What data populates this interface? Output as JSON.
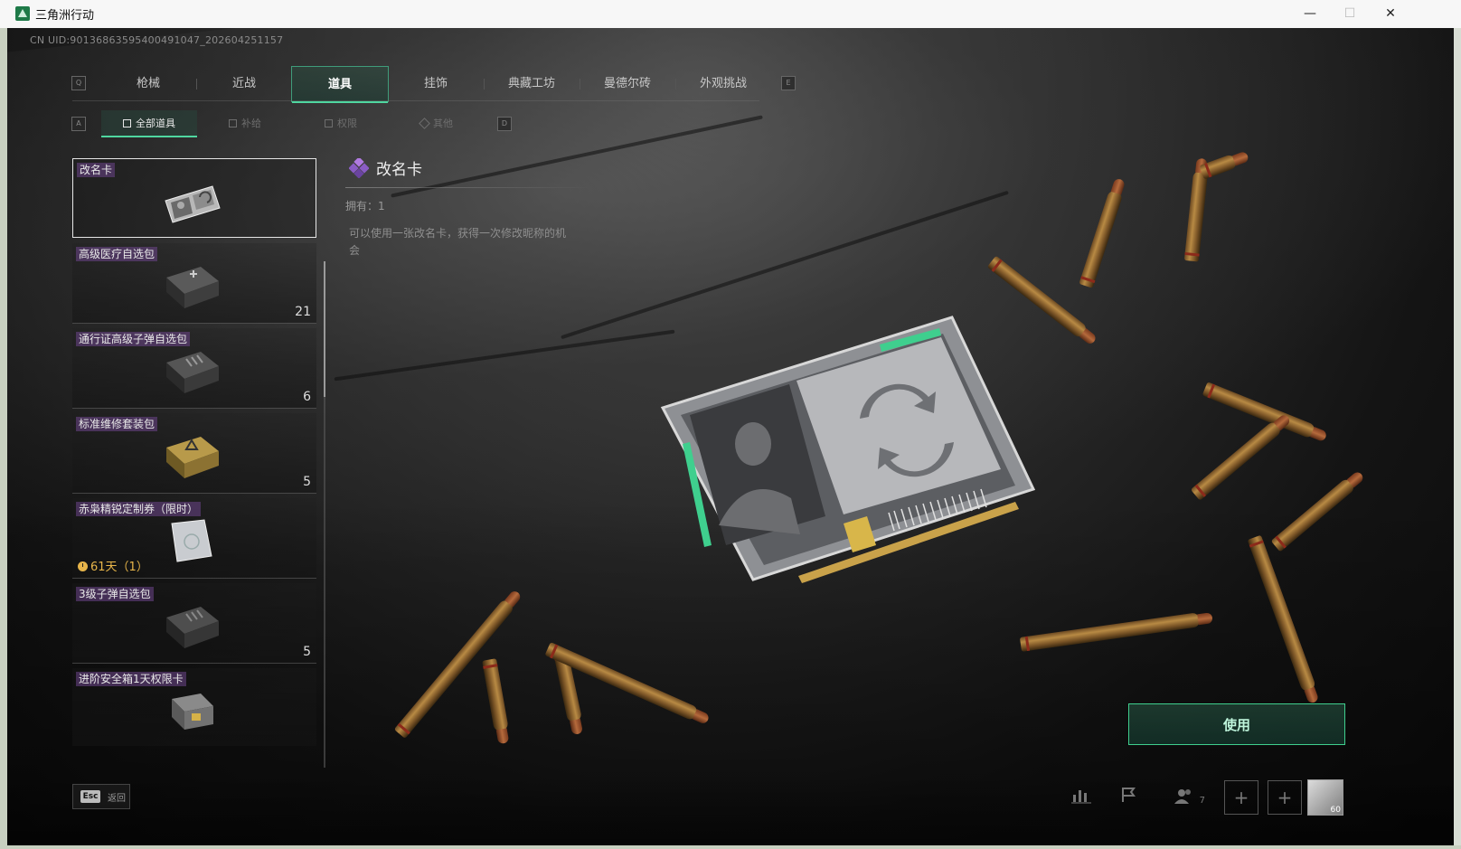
{
  "window": {
    "title": "三角洲行动",
    "minimize": "—",
    "maximize": "☐",
    "close": "✕"
  },
  "uid": "CN UID:9013686359540049104­7_202604251157",
  "main_tabs": [
    {
      "label": "枪械",
      "active": false
    },
    {
      "label": "近战",
      "active": false
    },
    {
      "label": "道具",
      "active": true
    },
    {
      "label": "挂饰",
      "active": false
    },
    {
      "label": "典藏工坊",
      "active": false
    },
    {
      "label": "曼德尔砖",
      "active": false
    },
    {
      "label": "外观挑战",
      "active": false
    }
  ],
  "main_tab_keys": {
    "left": "Q",
    "right": "E"
  },
  "sub_tabs": [
    {
      "label": "全部道具",
      "active": true
    },
    {
      "label": "补给",
      "active": false
    },
    {
      "label": "权限",
      "active": false
    },
    {
      "label": "其他",
      "active": false
    }
  ],
  "sub_tab_keys": {
    "left": "A",
    "right": "D"
  },
  "items": [
    {
      "name": "改名卡",
      "count": "",
      "timer": "",
      "selected": true
    },
    {
      "name": "高级医疗自选包",
      "count": "21",
      "timer": "",
      "selected": false
    },
    {
      "name": "通行证高级子弹自选包",
      "count": "6",
      "timer": "",
      "selected": false
    },
    {
      "name": "标准维修套装包",
      "count": "5",
      "timer": "",
      "selected": false
    },
    {
      "name": "赤枭精锐定制券（限时）",
      "count": "",
      "timer": "61天（1）",
      "selected": false
    },
    {
      "name": "3级子弹自选包",
      "count": "5",
      "timer": "",
      "selected": false
    },
    {
      "name": "进阶安全箱1天权限卡",
      "count": "",
      "timer": "",
      "selected": false
    }
  ],
  "detail": {
    "title": "改名卡",
    "owned": "拥有：1",
    "description": "可以使用一张改名卡，获得一次修改昵称的机会"
  },
  "use_button": "使用",
  "bottom": {
    "esc_key": "Esc",
    "back_label": "返回",
    "friends_count": "7",
    "avatar_level": "60"
  },
  "colors": {
    "accent": "#4fd7a0",
    "use_border": "#3fcf8e",
    "item_name_bg": "#6e468c",
    "timer": "#e7b54a"
  }
}
